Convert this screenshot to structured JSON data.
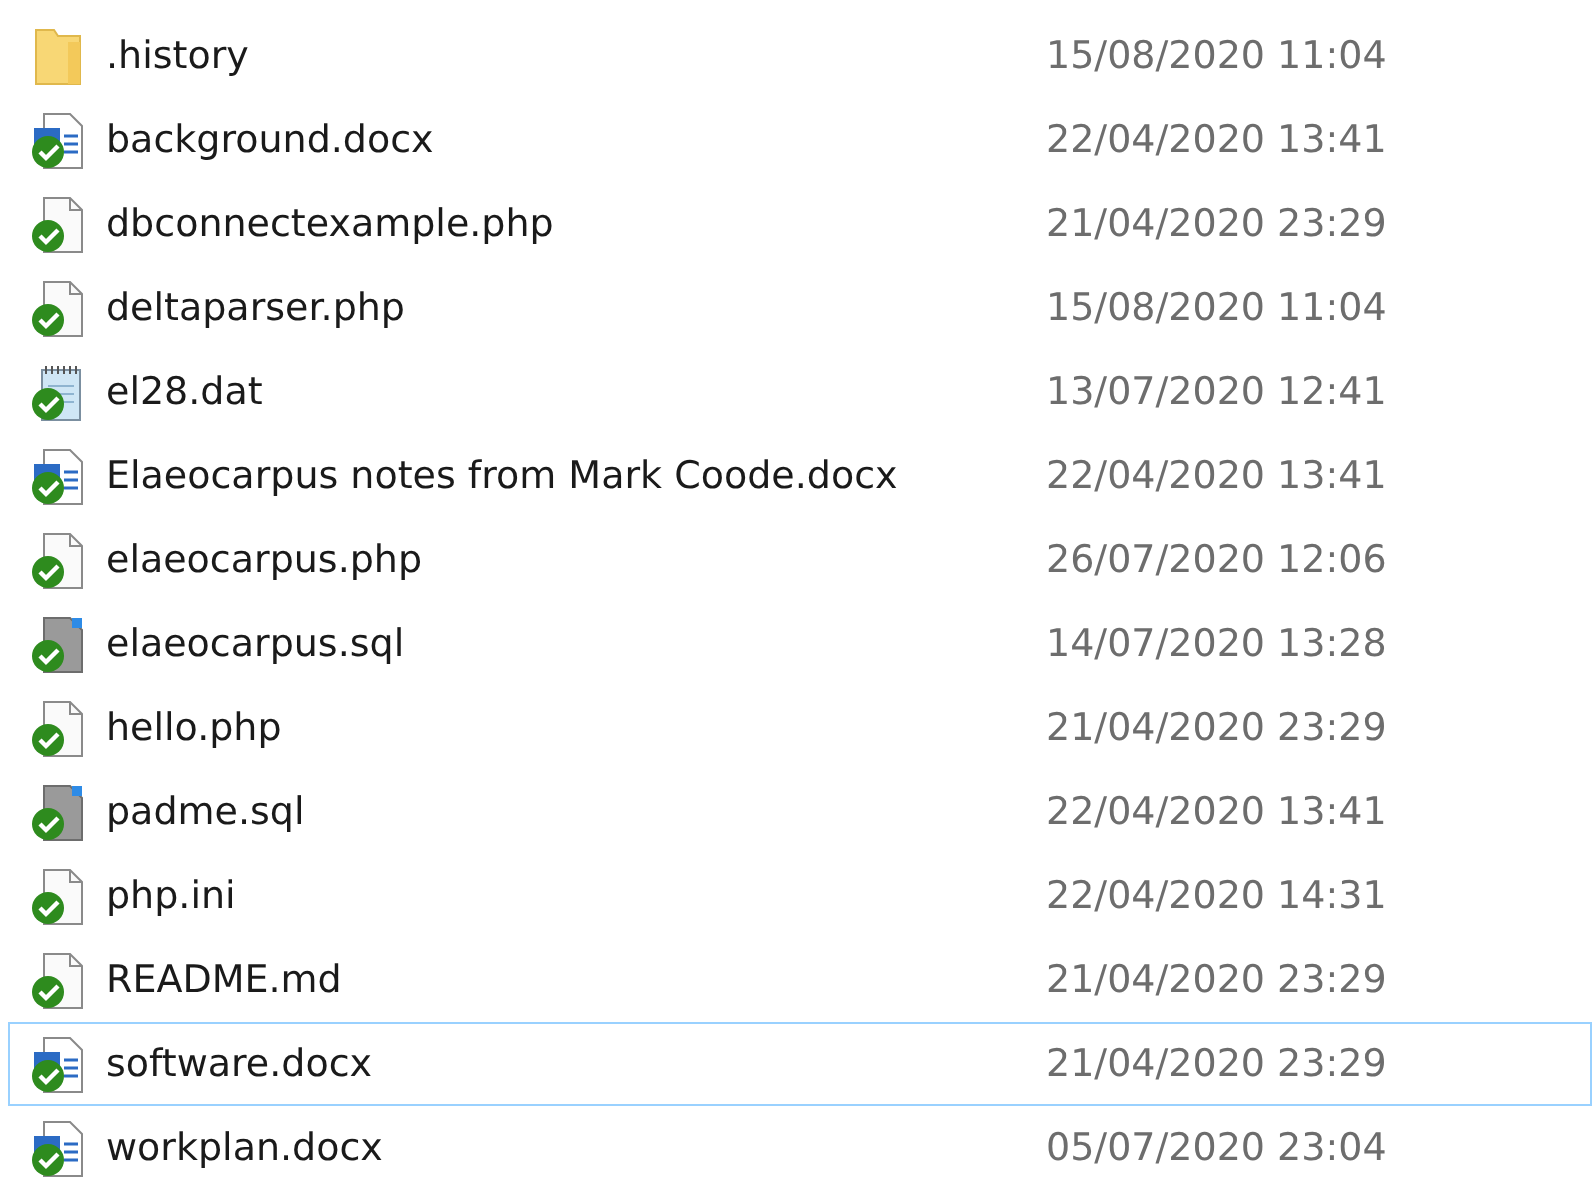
{
  "files": [
    {
      "name": ".history",
      "date": "15/08/2020 11:04",
      "kind": "folder",
      "synced": false,
      "focused": false
    },
    {
      "name": "background.docx",
      "date": "22/04/2020 13:41",
      "kind": "word",
      "synced": true,
      "focused": false
    },
    {
      "name": "dbconnectexample.php",
      "date": "21/04/2020 23:29",
      "kind": "generic",
      "synced": true,
      "focused": false
    },
    {
      "name": "deltaparser.php",
      "date": "15/08/2020 11:04",
      "kind": "generic",
      "synced": true,
      "focused": false
    },
    {
      "name": "el28.dat",
      "date": "13/07/2020 12:41",
      "kind": "notepad",
      "synced": true,
      "focused": false
    },
    {
      "name": "Elaeocarpus notes from Mark Coode.docx",
      "date": "22/04/2020 13:41",
      "kind": "word",
      "synced": true,
      "focused": false
    },
    {
      "name": "elaeocarpus.php",
      "date": "26/07/2020 12:06",
      "kind": "generic",
      "synced": true,
      "focused": false
    },
    {
      "name": "elaeocarpus.sql",
      "date": "14/07/2020 13:28",
      "kind": "sql",
      "synced": true,
      "focused": false
    },
    {
      "name": "hello.php",
      "date": "21/04/2020 23:29",
      "kind": "generic",
      "synced": true,
      "focused": false
    },
    {
      "name": "padme.sql",
      "date": "22/04/2020 13:41",
      "kind": "sql",
      "synced": true,
      "focused": false
    },
    {
      "name": "php.ini",
      "date": "22/04/2020 14:31",
      "kind": "generic",
      "synced": true,
      "focused": false
    },
    {
      "name": "README.md",
      "date": "21/04/2020 23:29",
      "kind": "generic",
      "synced": true,
      "focused": false
    },
    {
      "name": "software.docx",
      "date": "21/04/2020 23:29",
      "kind": "word",
      "synced": true,
      "focused": true
    },
    {
      "name": "workplan.docx",
      "date": "05/07/2020 23:04",
      "kind": "word",
      "synced": true,
      "focused": false
    }
  ]
}
